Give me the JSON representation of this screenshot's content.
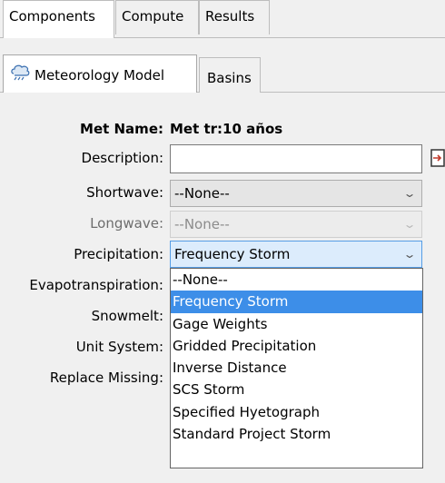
{
  "top_tabs": [
    {
      "label": "Components",
      "active": true
    },
    {
      "label": "Compute",
      "active": false
    },
    {
      "label": "Results",
      "active": false
    }
  ],
  "sub_tabs": [
    {
      "label": "Meteorology Model",
      "icon": "meteorology-icon",
      "active": true
    },
    {
      "label": "Basins",
      "active": false
    }
  ],
  "form": {
    "met_name_label": "Met Name:",
    "met_name_value": "Met tr:10 años",
    "description_label": "Description:",
    "description_value": "",
    "shortwave_label": "Shortwave:",
    "shortwave_value": "--None--",
    "longwave_label": "Longwave:",
    "longwave_value": "--None--",
    "precipitation_label": "Precipitation:",
    "precipitation_value": "Frequency Storm",
    "evapotranspiration_label": "Evapotranspiration:",
    "snowmelt_label": "Snowmelt:",
    "unit_system_label": "Unit System:",
    "replace_missing_label": "Replace Missing:"
  },
  "precipitation_options": [
    "--None--",
    "Frequency Storm",
    "Gage Weights",
    "Gridded Precipitation",
    "Inverse Distance",
    "SCS Storm",
    "Specified Hyetograph",
    "Standard Project Storm"
  ],
  "selected_option": "Frequency Storm",
  "colors": {
    "selection": "#3d8ee8",
    "focus_bg": "#dcecfc"
  }
}
